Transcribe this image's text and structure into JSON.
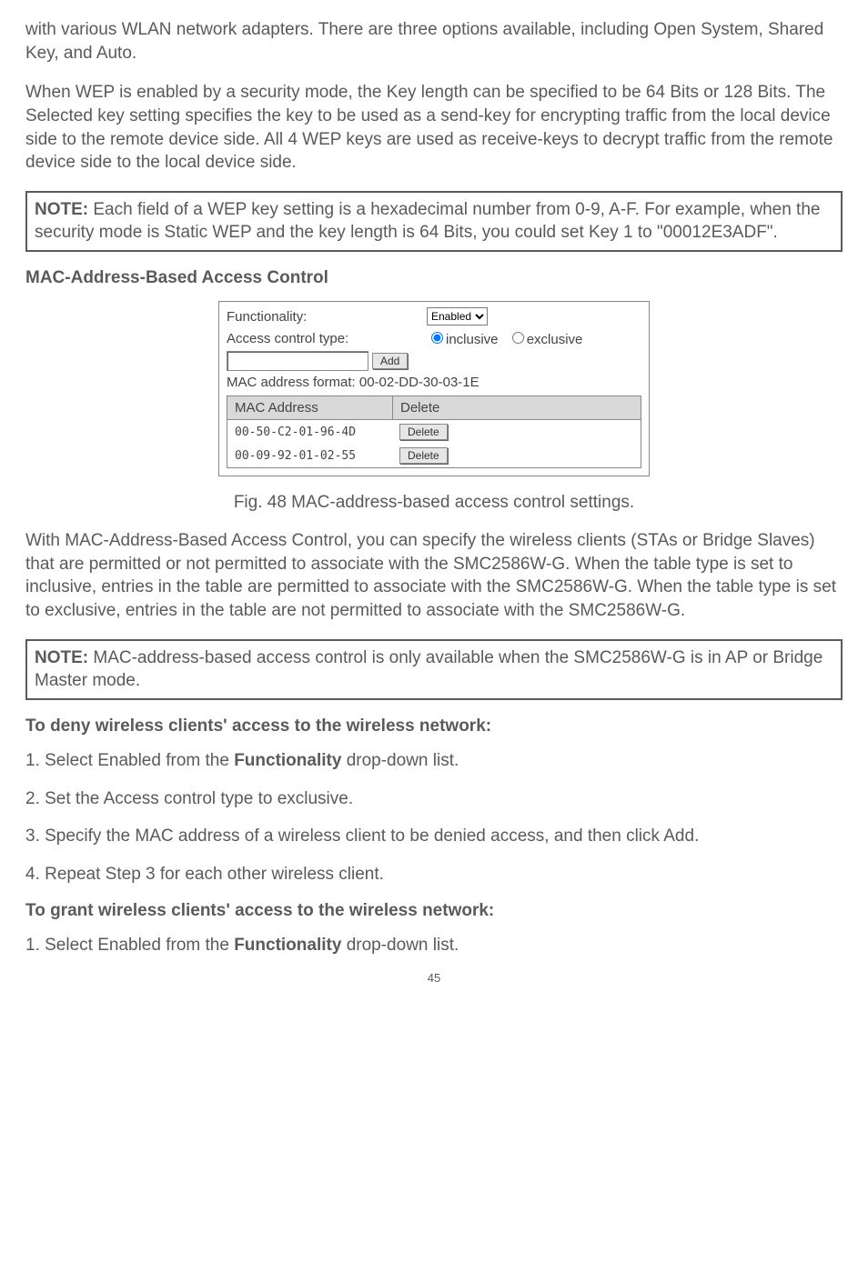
{
  "para1": "with various WLAN network adapters. There are three options available, including Open System, Shared Key, and Auto.",
  "para2": "When WEP is enabled by a security mode, the Key length can be specified to be 64 Bits or 128 Bits. The Selected key setting specifies the key to be used as a send-key for encrypting traffic from the local device side to the remote device side. All 4 WEP keys are used as receive-keys to decrypt traffic from the remote device side to the local device side.",
  "note1_label": "NOTE:",
  "note1_text": " Each field of a WEP key setting is a hexadecimal number from 0-9, A-F. For example, when the security mode is Static WEP and the key length is 64 Bits, you could set Key 1 to \"00012E3ADF\".",
  "heading_mac": "MAC-Address-Based Access Control",
  "mac_panel": {
    "functionality_label": "Functionality:",
    "functionality_value": "Enabled",
    "access_type_label": "Access control type:",
    "radio_inclusive": "inclusive",
    "radio_exclusive": "exclusive",
    "add_button": "Add",
    "format_line": "MAC address format: 00-02-DD-30-03-1E",
    "header_addr": "MAC Address",
    "header_delete": "Delete",
    "rows": [
      {
        "addr": "00-50-C2-01-96-4D",
        "btn": "Delete"
      },
      {
        "addr": "00-09-92-01-02-55",
        "btn": "Delete"
      }
    ]
  },
  "fig_caption": "Fig. 48 MAC-address-based access control settings.",
  "para3": "With MAC-Address-Based Access Control, you can specify the wireless clients (STAs or Bridge Slaves) that are permitted or not permitted to associate with the SMC2586W-G. When the table type is set to inclusive, entries in the table are permitted to associate with the SMC2586W-G. When the table type is set to exclusive, entries in the table are not permitted to associate with the SMC2586W-G.",
  "note2_label": "NOTE:",
  "note2_text": " MAC-address-based access control is only available when the SMC2586W-G is in AP or Bridge Master mode.",
  "heading_deny": "To deny wireless clients' access to the wireless network:",
  "deny_steps": {
    "s1_pre": "1. Select Enabled from the ",
    "s1_bold": "Functionality",
    "s1_post": " drop-down list.",
    "s2": "2. Set the Access control type to exclusive.",
    "s3": "3. Specify the MAC address of a wireless client to be denied access, and then click Add.",
    "s4": "4. Repeat Step 3 for each other wireless client."
  },
  "heading_grant": "To grant wireless clients' access to the wireless network:",
  "grant_steps": {
    "s1_pre": "1. Select Enabled from the ",
    "s1_bold": "Functionality",
    "s1_post": " drop-down list."
  },
  "page_number": "45"
}
